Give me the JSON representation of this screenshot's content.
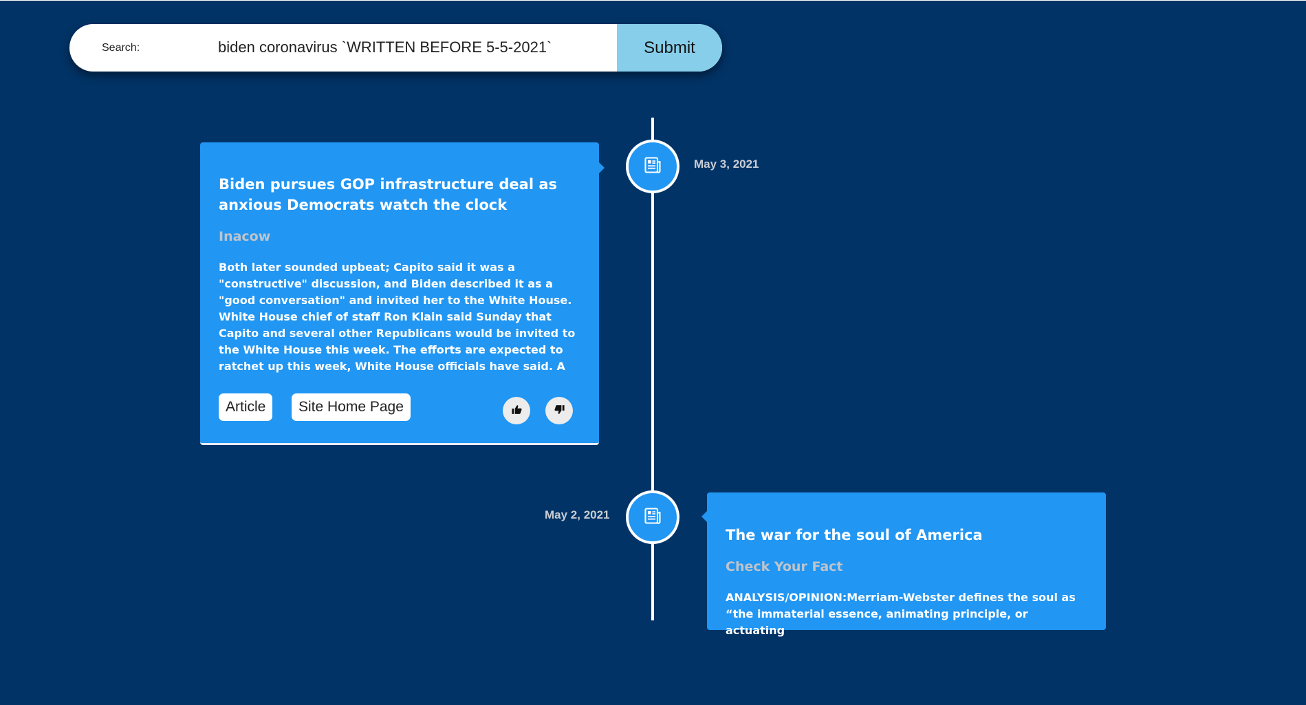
{
  "search": {
    "label": "Search:",
    "value": "biden coronavirus `WRITTEN BEFORE 5-5-2021`",
    "submit_label": "Submit"
  },
  "timeline": [
    {
      "date": "May 3, 2021",
      "title": "Biden pursues GOP infrastructure deal as anxious Democrats watch the clock",
      "source": "Inacow",
      "body": "Both later sounded upbeat; Capito said it was a \"constructive\" discussion, and Biden described it as a \"good conversation\" and invited her to the White House. White House chief of staff Ron Klain said Sunday that Capito and several other Republicans would be invited to the White House this week. The efforts are expected to ratchet up this week, White House officials have said. A person close to the White House",
      "article_label": "Article",
      "home_label": "Site Home Page"
    },
    {
      "date": "May 2, 2021",
      "title": "The war for the soul of America",
      "source": "Check Your Fact",
      "body": "ANALYSIS/OPINION:Merriam-Webster defines the soul as “the immaterial essence, animating principle, or actuating"
    }
  ],
  "colors": {
    "background": "#023366",
    "card": "#2196f3",
    "submit": "#87ceeb"
  },
  "icons": {
    "node": "newspaper-icon",
    "like": "thumbs-up-icon",
    "dislike": "thumbs-down-icon"
  }
}
